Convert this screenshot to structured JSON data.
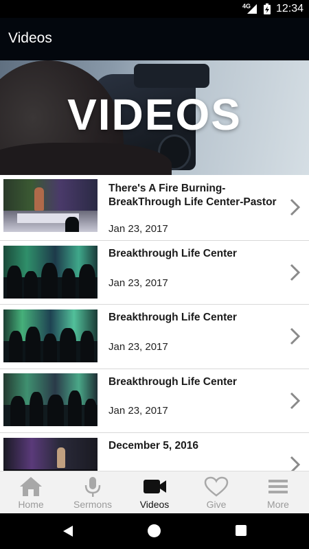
{
  "status_bar": {
    "network": "4G",
    "time": "12:34"
  },
  "app_bar": {
    "title": "Videos"
  },
  "hero": {
    "title": "VIDEOS"
  },
  "videos": [
    {
      "title": "There's A Fire Burning-BreakThrough Life Center-Pastor",
      "date": "Jan 23, 2017"
    },
    {
      "title": "Breakthrough Life Center",
      "date": "Jan 23, 2017"
    },
    {
      "title": "Breakthrough Life Center",
      "date": "Jan 23, 2017"
    },
    {
      "title": "Breakthrough Life Center",
      "date": "Jan 23, 2017"
    },
    {
      "title": "December 5, 2016",
      "date": ""
    }
  ],
  "bottom_nav": [
    {
      "label": "Home",
      "icon": "home-icon",
      "active": false
    },
    {
      "label": "Sermons",
      "icon": "microphone-icon",
      "active": false
    },
    {
      "label": "Videos",
      "icon": "video-camera-icon",
      "active": true
    },
    {
      "label": "Give",
      "icon": "heart-icon",
      "active": false
    },
    {
      "label": "More",
      "icon": "menu-icon",
      "active": false
    }
  ],
  "colors": {
    "app_bar": "#03070d",
    "nav_active": "#111111",
    "nav_inactive": "#9a9a9a"
  }
}
